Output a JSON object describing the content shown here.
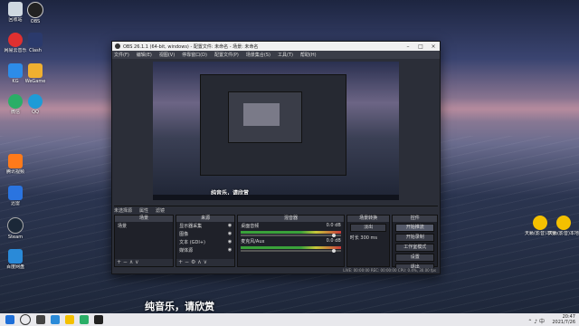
{
  "desktop_icons": [
    {
      "label": "回收站",
      "color": "#cfd8e0"
    },
    {
      "label": "OBS",
      "color": "#222222"
    },
    {
      "label": "网易云音乐",
      "color": "#e03030"
    },
    {
      "label": "Clash",
      "color": "#2b3a6c"
    },
    {
      "label": "KG",
      "color": "#2d8ce8"
    },
    {
      "label": "WeGame",
      "color": "#f0b030"
    },
    {
      "label": "微信",
      "color": "#2aae67"
    },
    {
      "label": "QQ",
      "color": "#1e9bd7"
    },
    {
      "label": "腾讯视频",
      "color": "#ff7a1a"
    },
    {
      "label": "迅雷",
      "color": "#2a74e0"
    },
    {
      "label": "Steam",
      "color": "#1b2838"
    },
    {
      "label": "百度网盘",
      "color": "#2a8ad8"
    }
  ],
  "right_icons": [
    {
      "label": "天籁(影音)本地",
      "color": "#f4c000"
    },
    {
      "label": "天籁(影音)本地工具",
      "color": "#f4c000"
    }
  ],
  "obs": {
    "title": "OBS 26.1.1 (64-bit, windows) - 配置文件: 未命名 - 场景: 未命名",
    "menu": [
      "文件(F)",
      "编辑(E)",
      "视图(V)",
      "停靠窗口(D)",
      "配置文件(P)",
      "场景集合(S)",
      "工具(T)",
      "帮助(H)"
    ],
    "scene_bar": [
      "未选择源",
      "属性",
      "滤镜"
    ],
    "subtitle_preview": "纯音乐，请欣赏",
    "docks": {
      "scenes": {
        "title": "场景",
        "items": [
          "场景"
        ]
      },
      "sources": {
        "title": "来源",
        "items": [
          "显示器采集",
          "图像",
          "文本 (GDI+)",
          "媒体源"
        ]
      },
      "mixer": {
        "title": "混音器",
        "tracks": [
          {
            "name": "桌面音频",
            "db": "0.0 dB"
          },
          {
            "name": "麦克风/Aux",
            "db": "0.0 dB"
          }
        ]
      },
      "transitions": {
        "title": "场景转换",
        "type": "淡出",
        "duration_label": "时长",
        "duration": "300 ms"
      },
      "controls": {
        "title": "控件",
        "buttons": [
          "开始推流",
          "开始录制",
          "工作室模式",
          "设置",
          "退出"
        ]
      }
    },
    "status": "LIVE: 00:00:00  REC: 00:00:00  CPU: 0.4%, 30.00 fps"
  },
  "subtitle": "纯音乐，请欣赏",
  "taskbar": {
    "time": "20:47",
    "date": "2021/7/26",
    "lang": "中"
  }
}
